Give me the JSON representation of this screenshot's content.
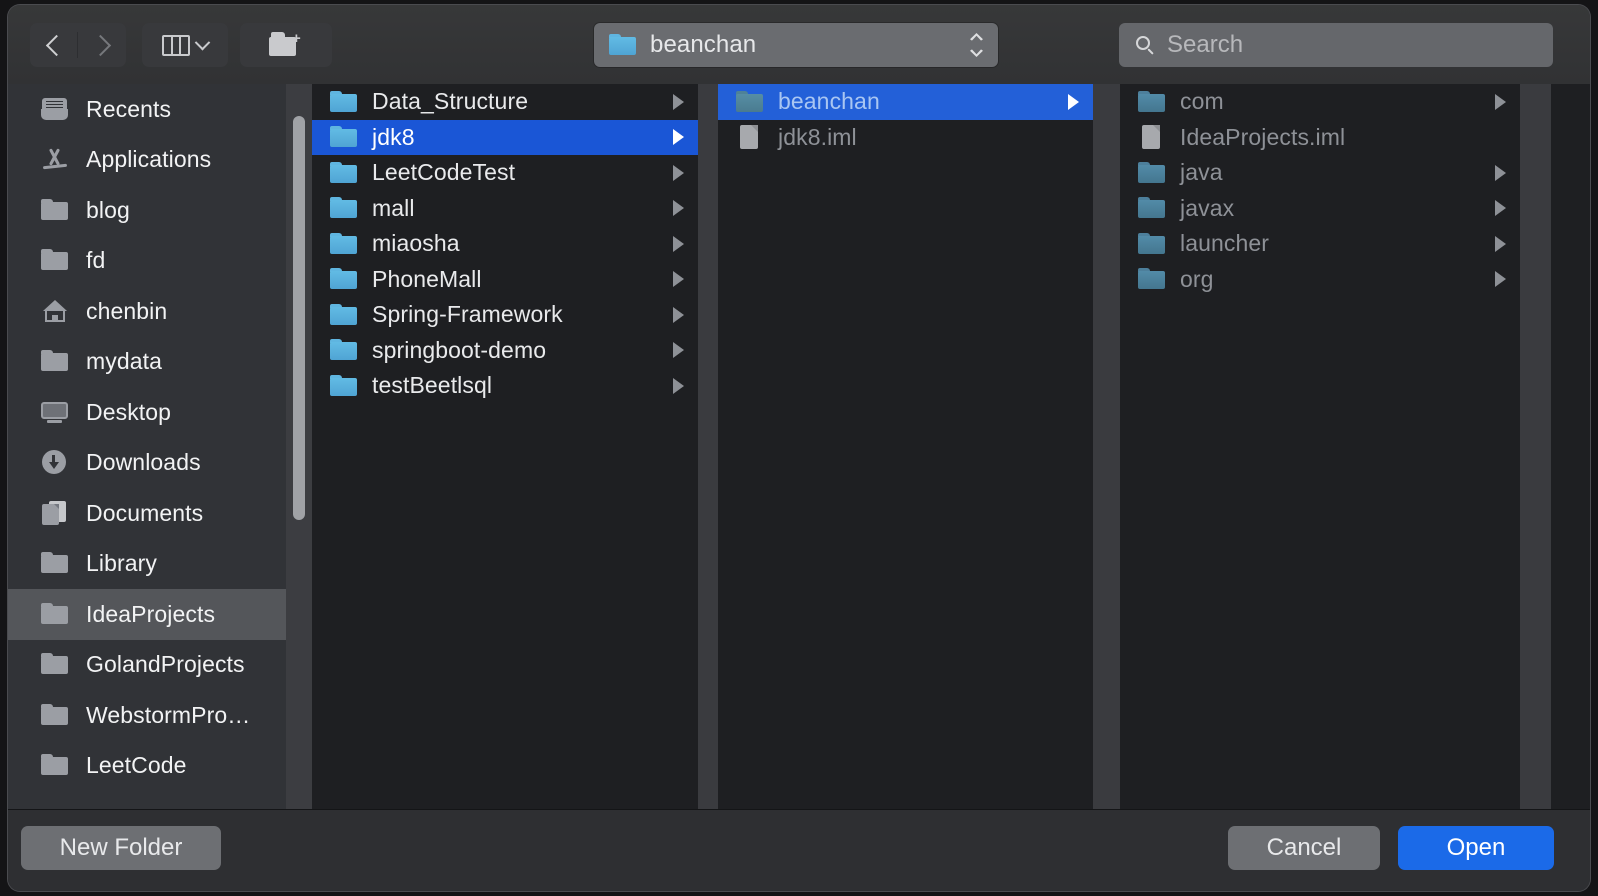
{
  "toolbar": {
    "back_icon": "chevron-left-icon",
    "forward_icon": "chevron-right-icon",
    "view_mode_icon": "column-view-icon",
    "new_folder_icon": "new-folder-icon",
    "path": {
      "label": "beanchan",
      "folder_icon": "blue-folder-icon",
      "stepper_icon": "up-down-stepper-icon"
    },
    "search": {
      "placeholder": "Search",
      "icon": "search-icon",
      "value": ""
    }
  },
  "sidebar": {
    "items": [
      {
        "label": "Recents",
        "icon": "recents-icon",
        "selected": false
      },
      {
        "label": "Applications",
        "icon": "applications-icon",
        "selected": false
      },
      {
        "label": "blog",
        "icon": "folder-icon",
        "selected": false
      },
      {
        "label": "fd",
        "icon": "folder-icon",
        "selected": false
      },
      {
        "label": "chenbin",
        "icon": "home-icon",
        "selected": false
      },
      {
        "label": "mydata",
        "icon": "folder-icon",
        "selected": false
      },
      {
        "label": "Desktop",
        "icon": "desktop-icon",
        "selected": false
      },
      {
        "label": "Downloads",
        "icon": "downloads-icon",
        "selected": false
      },
      {
        "label": "Documents",
        "icon": "documents-icon",
        "selected": false
      },
      {
        "label": "Library",
        "icon": "folder-icon",
        "selected": false
      },
      {
        "label": "IdeaProjects",
        "icon": "folder-icon",
        "selected": true
      },
      {
        "label": "GolandProjects",
        "icon": "folder-icon",
        "selected": false
      },
      {
        "label": "WebstormPro…",
        "icon": "folder-icon",
        "selected": false
      },
      {
        "label": "LeetCode",
        "icon": "folder-icon",
        "selected": false
      }
    ]
  },
  "columns": [
    {
      "name": "column-1",
      "rows": [
        {
          "label": "Data_Structure",
          "type": "folder",
          "expandable": true,
          "state": "normal"
        },
        {
          "label": "jdk8",
          "type": "folder",
          "expandable": true,
          "state": "selected-active"
        },
        {
          "label": "LeetCodeTest",
          "type": "folder",
          "expandable": true,
          "state": "normal"
        },
        {
          "label": "mall",
          "type": "folder",
          "expandable": true,
          "state": "normal"
        },
        {
          "label": "miaosha",
          "type": "folder",
          "expandable": true,
          "state": "normal"
        },
        {
          "label": "PhoneMall",
          "type": "folder",
          "expandable": true,
          "state": "normal"
        },
        {
          "label": "Spring-Framework",
          "type": "folder",
          "expandable": true,
          "state": "normal"
        },
        {
          "label": "springboot-demo",
          "type": "folder",
          "expandable": true,
          "state": "normal"
        },
        {
          "label": "testBeetlsql",
          "type": "folder",
          "expandable": true,
          "state": "normal"
        }
      ]
    },
    {
      "name": "column-2",
      "rows": [
        {
          "label": "beanchan",
          "type": "folder",
          "expandable": true,
          "state": "selected-inactive"
        },
        {
          "label": "jdk8.iml",
          "type": "file",
          "expandable": false,
          "state": "dim"
        }
      ]
    },
    {
      "name": "column-3",
      "rows": [
        {
          "label": "com",
          "type": "folder",
          "expandable": true,
          "state": "dim"
        },
        {
          "label": "IdeaProjects.iml",
          "type": "file",
          "expandable": false,
          "state": "dim"
        },
        {
          "label": "java",
          "type": "folder",
          "expandable": true,
          "state": "dim"
        },
        {
          "label": "javax",
          "type": "folder",
          "expandable": true,
          "state": "dim"
        },
        {
          "label": "launcher",
          "type": "folder",
          "expandable": true,
          "state": "dim"
        },
        {
          "label": "org",
          "type": "folder",
          "expandable": true,
          "state": "dim"
        }
      ]
    }
  ],
  "annotation": {
    "color": "#ff0d0d",
    "targets": "beanchan"
  },
  "footer": {
    "new_folder_label": "New Folder",
    "cancel_label": "Cancel",
    "open_label": "Open"
  },
  "colors": {
    "selection_active": "#1a56d6",
    "selection_inactive": "#2360d8",
    "primary_button": "#1b6ae8",
    "sidebar_bg": "#313337",
    "column_bg": "#1e1f22",
    "annotation": "#ff0d0d"
  }
}
